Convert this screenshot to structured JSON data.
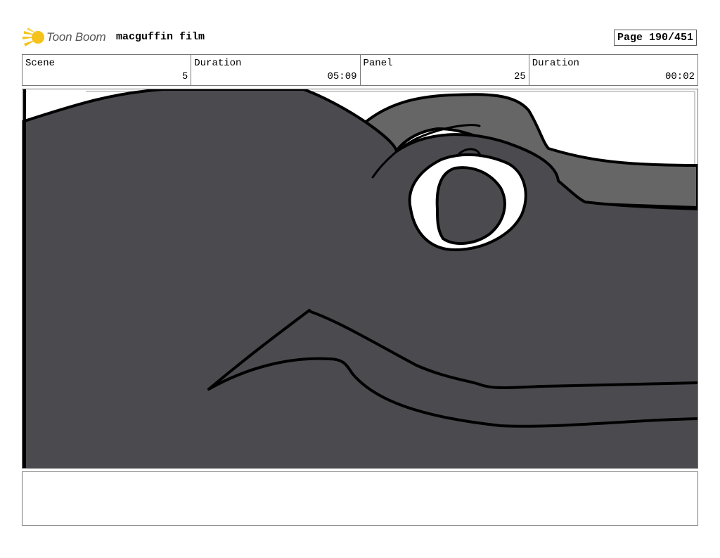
{
  "header": {
    "logo_text": "Toon Boom",
    "project_title": "macguffin film",
    "page_label": "Page 190/451"
  },
  "info": [
    {
      "label": "Scene",
      "value": "5"
    },
    {
      "label": "Duration",
      "value": "05:09"
    },
    {
      "label": "Panel",
      "value": "25"
    },
    {
      "label": "Duration",
      "value": "00:02"
    }
  ],
  "panel": {
    "description": "",
    "colors": {
      "body": "#4b4a4f",
      "crest": "#666666",
      "outline": "#000000",
      "eye_white": "#ffffff"
    }
  },
  "notes": {
    "text": ""
  }
}
